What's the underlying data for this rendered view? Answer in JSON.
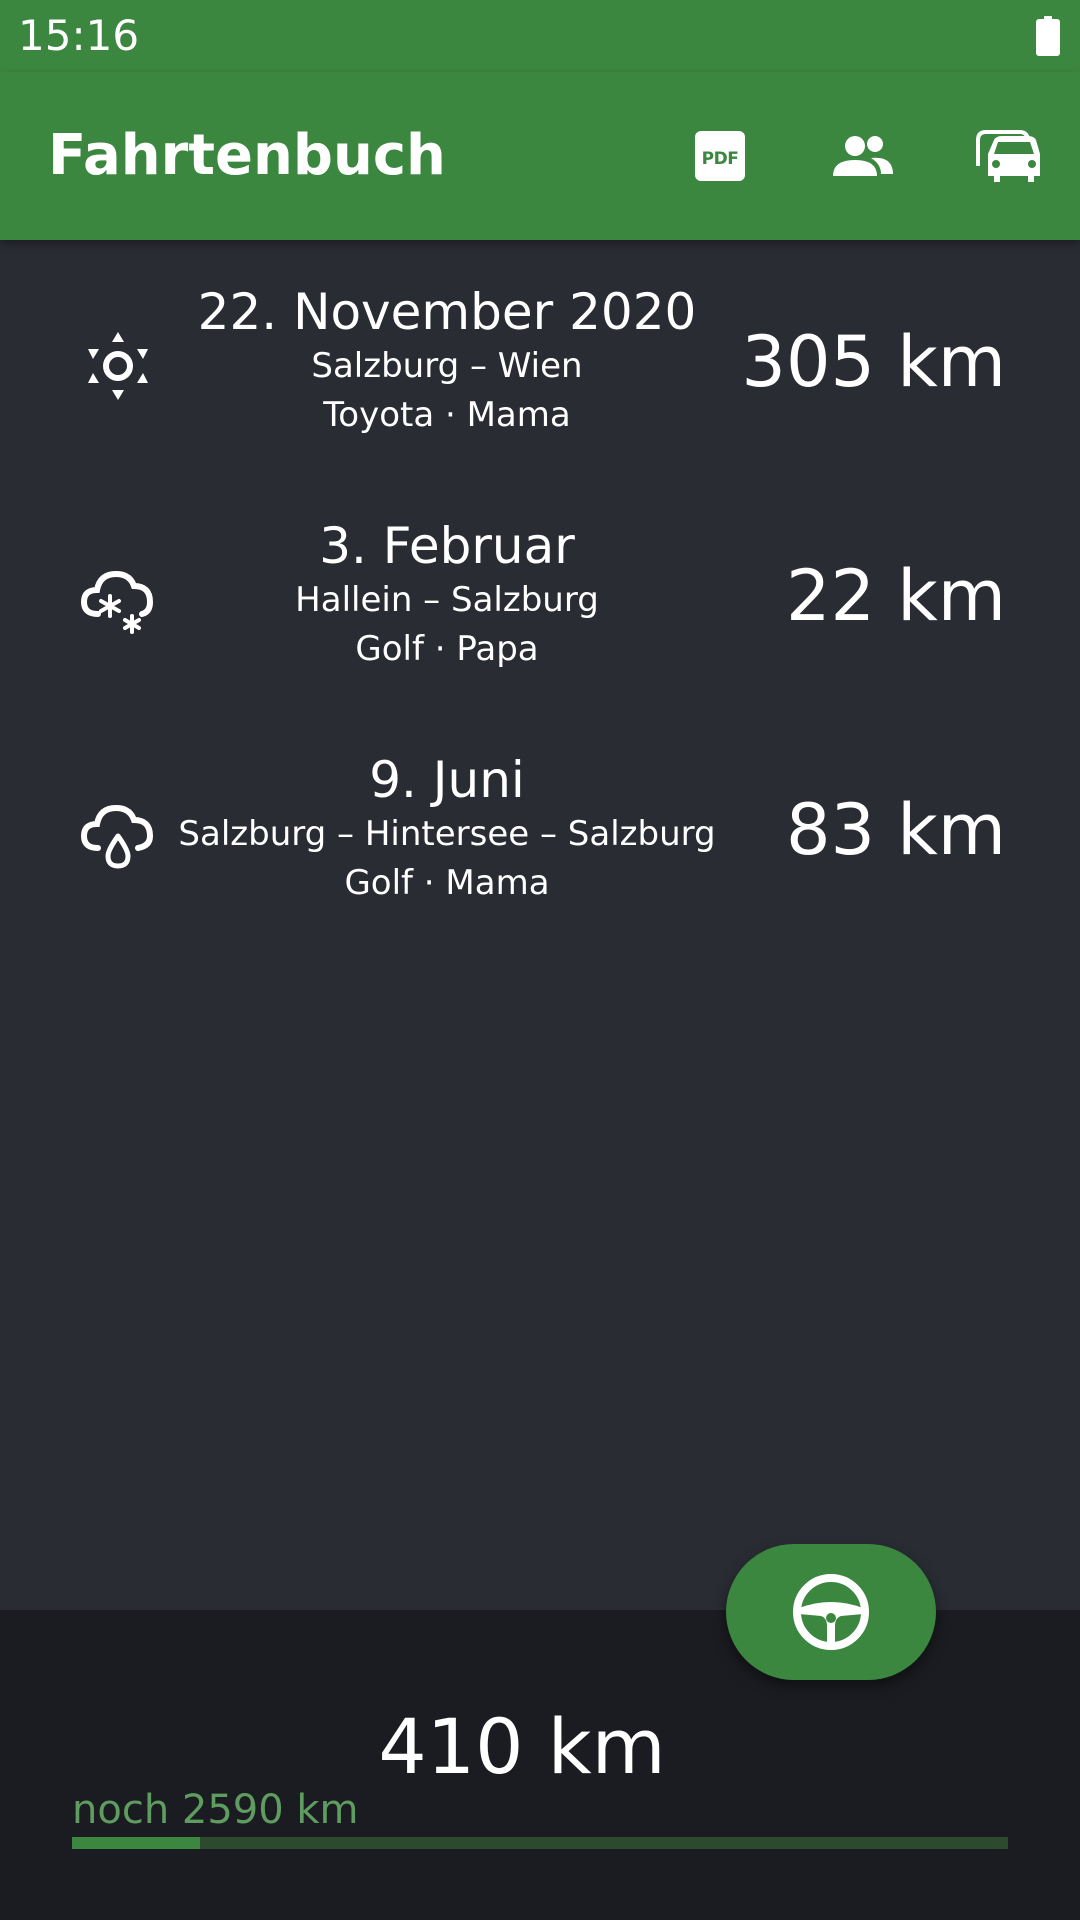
{
  "status_bar": {
    "time": "15:16",
    "battery_icon": "battery-full-icon"
  },
  "app_bar": {
    "title": "Fahrtenbuch",
    "actions": [
      {
        "icon": "pdf-icon"
      },
      {
        "icon": "people-icon"
      },
      {
        "icon": "cars-icon"
      }
    ],
    "color": "#3b873f"
  },
  "trips": [
    {
      "weather_icon": "sun-icon",
      "date": "22. November 2020",
      "route": "Salzburg – Wien",
      "meta": "Toyota · Mama",
      "distance": "305 km"
    },
    {
      "weather_icon": "snow-cloud-icon",
      "date": "3. Februar",
      "route": "Hallein – Salzburg",
      "meta": "Golf · Papa",
      "distance": "22 km"
    },
    {
      "weather_icon": "rain-cloud-icon",
      "date": "9. Juni",
      "route": "Salzburg – Hintersee – Salzburg",
      "meta": "Golf · Mama",
      "distance": "83 km"
    }
  ],
  "summary": {
    "total": "410 km",
    "remaining": "noch 2590 km",
    "progress_fraction": 0.137
  },
  "fab": {
    "icon": "steering-wheel-icon"
  },
  "colors": {
    "accent": "#3b873f",
    "background": "#2a2c34",
    "bottom_panel": "#1b1c21",
    "remaining_text": "#5f9c5f",
    "progress_track": "#2c4a2e"
  }
}
